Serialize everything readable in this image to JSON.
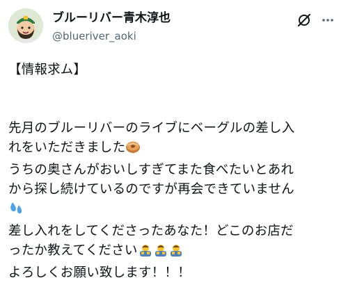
{
  "author": {
    "display_name": "ブルーリバー青木淳也",
    "handle": "@blueriver_aoki"
  },
  "icons": {
    "grok": "grok-icon",
    "more": "more-options-icon",
    "avatar": "avatar-illustration"
  },
  "post": {
    "line1": "【情報求ム】",
    "line2": "先月のブルーリバーのライブにベーグルの差し入",
    "line3": "れをいただきました",
    "line4": "うちの奥さんがおいしすぎてまた食べたいとあれ",
    "line5": "から探し続けているのですが再会できていません",
    "line6": "差し入れをしてくださったあなた！どこのお店だ",
    "line7": "ったか教えてください",
    "line8": "よろしくお願い致します！！！",
    "emojis": {
      "bagel": "bagel-emoji",
      "sweat": "sweat-droplets-emoji",
      "bow": "bowing-person-emoji"
    }
  }
}
